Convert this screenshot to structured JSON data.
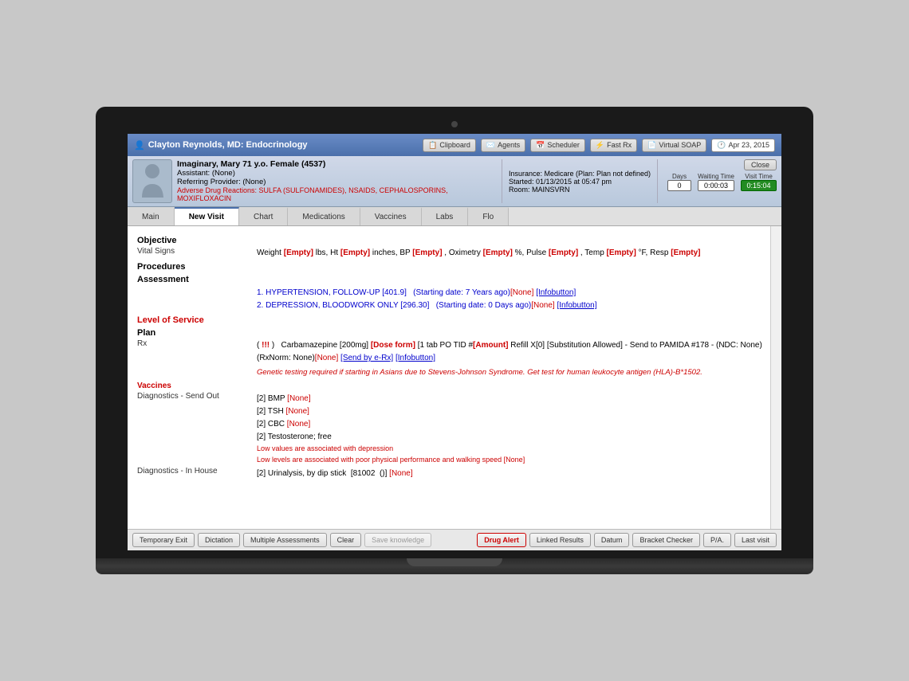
{
  "topbar": {
    "provider": "Clayton Reynolds, MD: Endocrinology",
    "clipboard": "Clipboard",
    "agents": "Agents",
    "scheduler": "Scheduler",
    "fast_rx": "Fast Rx",
    "virtual_soap": "Virtual SOAP",
    "date": "Apr 23, 2015"
  },
  "patient": {
    "name": "Imaginary, Mary 71 y.o. Female (4537)",
    "assistant": "Assistant: (None)",
    "referring": "Referring Provider: (None)",
    "adverse": "Adverse Drug Reactions: SULFA (SULFONAMIDES), NSAIDS, CEPHALOSPORINS, MOXIFLOXACIN",
    "insurance": "Insurance: Medicare (Plan: Plan not defined)",
    "started": "Started: 01/13/2015 at 05:47 pm",
    "room": "Room: MAINSVRN",
    "days_label": "Days",
    "days_value": "0",
    "waiting_label": "Waiting Time",
    "waiting_value": "0:00:03",
    "visit_label": "Visit Time",
    "visit_value": "0:15:04",
    "close": "Close"
  },
  "tabs": [
    {
      "label": "Main",
      "active": false
    },
    {
      "label": "New Visit",
      "active": true
    },
    {
      "label": "Chart",
      "active": false
    },
    {
      "label": "Medications",
      "active": false
    },
    {
      "label": "Vaccines",
      "active": false
    },
    {
      "label": "Labs",
      "active": false
    },
    {
      "label": "Flo",
      "active": false
    }
  ],
  "content": {
    "objective_title": "Objective",
    "vital_signs_label": "Vital Signs",
    "vital_signs": "Weight [Empty] lbs, Ht [Empty] inches, BP [Empty] , Oximetry [Empty] %, Pulse [Empty] , Temp [Empty] °F, Resp [Empty]",
    "procedures_title": "Procedures",
    "assessment_title": "Assessment",
    "assessment_items": [
      "1. HYPERTENSION, FOLLOW-UP [401.9]   (Starting date: 7 Years ago)[None] [Infobutton]",
      "2. DEPRESSION, BLOODWORK ONLY [296.30]   (Starting date: 0 Days ago)[None] [Infobutton]"
    ],
    "level_of_service": "Level of Service",
    "plan_title": "Plan",
    "rx_label": "Rx",
    "rx_content": "( !!! )   Carbamazepine [200mg] [Dose form] [1 tab PO TID #[Amount] Refill X[0] [Substitution Allowed] - Send to PAMIDA #178 - (NDC: None) (RxNorm: None)[None] [Send by e-Rx] [Infobutton]",
    "rx_warning": "Genetic testing required if starting in Asians due to Stevens-Johnson Syndrome. Get test for human leukocyte antigen (HLA)-B*1502.",
    "vaccines_label": "Vaccines",
    "diagnostics_send_label": "Diagnostics - Send Out",
    "diagnostics_send_items": [
      "[2] BMP [None]",
      "[2] TSH [None]",
      "[2] CBC [None]",
      "[2] Testosterone; free",
      "Low values are associated with depression",
      "Low levels are associated with poor physical performance and walking speed [None]"
    ],
    "diagnostics_house_label": "Diagnostics - In House",
    "diagnostics_house_items": [
      "[2] Urinalysis, by dip stick  [81002  ()] [None]"
    ]
  },
  "bottom_bar": {
    "temporary_exit": "Temporary Exit",
    "dictation": "Dictation",
    "multiple_assessments": "Multiple Assessments",
    "clear": "Clear",
    "save_knowledge": "Save knowledge",
    "drug_alert": "Drug Alert",
    "linked_results": "Linked Results",
    "datum": "Datum",
    "bracket_checker": "Bracket Checker",
    "pa": "P/A.",
    "last_visit": "Last visit"
  }
}
